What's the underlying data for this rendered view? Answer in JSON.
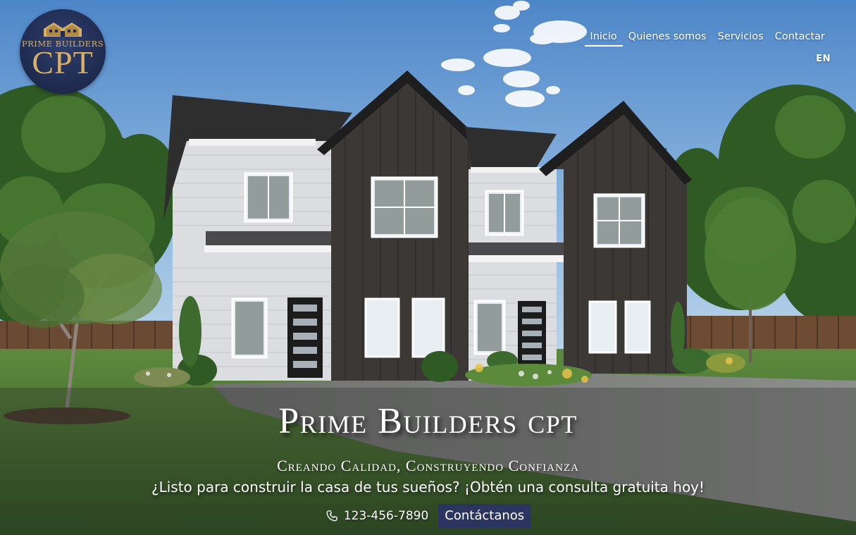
{
  "logo": {
    "line1": "PRIME BUILDERS",
    "line2": "CPT",
    "icon": "house-icon"
  },
  "nav": {
    "items": [
      {
        "label": "Inicio",
        "active": true
      },
      {
        "label": "Quienes somos",
        "active": false
      },
      {
        "label": "Servicios",
        "active": false
      },
      {
        "label": "Contactar",
        "active": false
      }
    ],
    "language": "EN"
  },
  "hero": {
    "title": "Prime Builders cpt",
    "tagline": "Creando Calidad, Construyendo Confianza",
    "subtitle": "¿Listo para construir la casa de tus sueños? ¡Obtén una consulta gratuita hoy!",
    "phone": "123-456-7890",
    "phone_icon": "phone-icon",
    "cta_label": "Contáctanos"
  },
  "colors": {
    "brand_navy": "#2b3560",
    "logo_gold": "#d8b066",
    "siding_dark": "#3b3836",
    "siding_light": "#dcdde0"
  }
}
